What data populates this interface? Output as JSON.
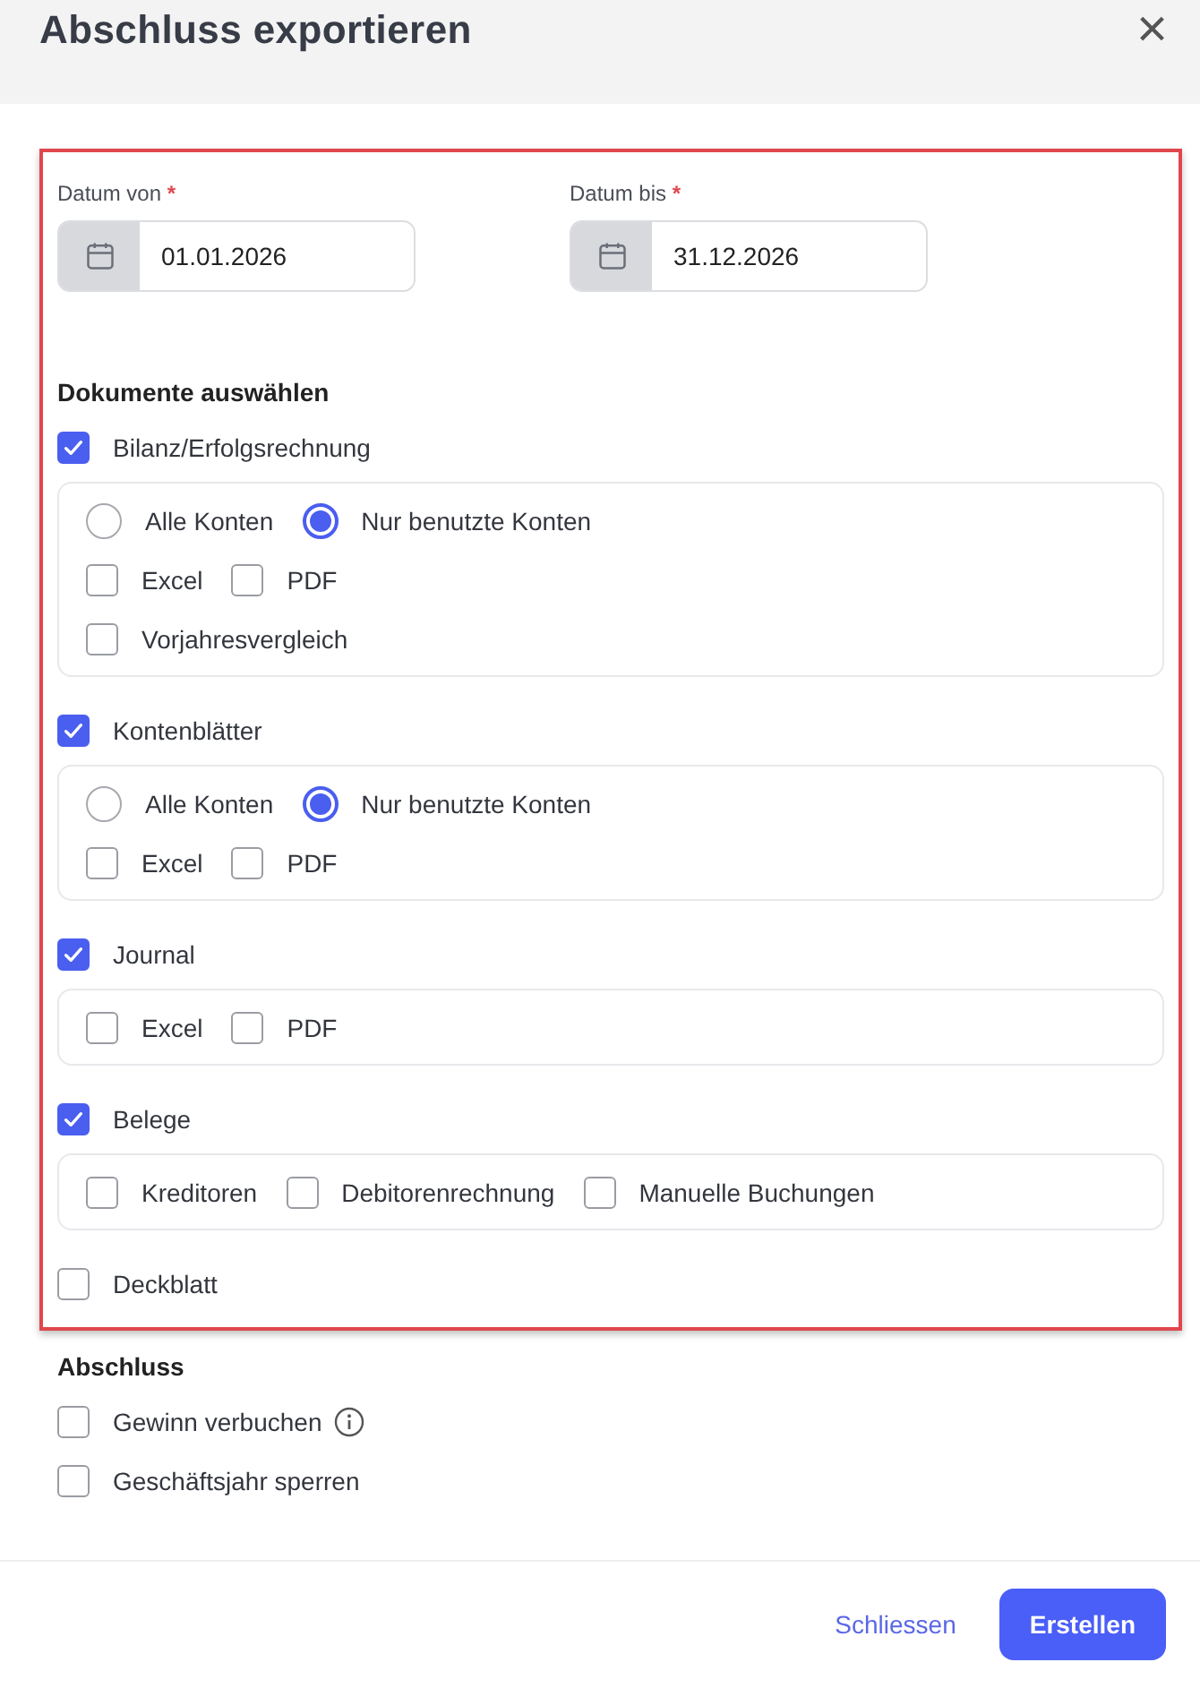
{
  "dialog": {
    "title": "Abschluss exportieren",
    "close": "×"
  },
  "dates": [
    {
      "label": "Datum von",
      "required": "*",
      "value": "01.01.2026"
    },
    {
      "label": "Datum bis",
      "required": "*",
      "value": "31.12.2026"
    }
  ],
  "documents": {
    "heading": "Dokumente auswählen",
    "items": [
      {
        "label": "Bilanz/Erfolgsrechnung",
        "checked": true,
        "options": [
          [
            {
              "kind": "radio",
              "label": "Alle Konten",
              "selected": false
            },
            {
              "kind": "radio",
              "label": "Nur benutzte Konten",
              "selected": true
            }
          ],
          [
            {
              "kind": "checkbox",
              "label": "Excel",
              "checked": false
            },
            {
              "kind": "checkbox",
              "label": "PDF",
              "checked": false
            }
          ],
          [
            {
              "kind": "checkbox",
              "label": "Vorjahresvergleich",
              "checked": false
            }
          ]
        ]
      },
      {
        "label": "Kontenblätter",
        "checked": true,
        "options": [
          [
            {
              "kind": "radio",
              "label": "Alle Konten",
              "selected": false
            },
            {
              "kind": "radio",
              "label": "Nur benutzte Konten",
              "selected": true
            }
          ],
          [
            {
              "kind": "checkbox",
              "label": "Excel",
              "checked": false
            },
            {
              "kind": "checkbox",
              "label": "PDF",
              "checked": false
            }
          ]
        ]
      },
      {
        "label": "Journal",
        "checked": true,
        "options": [
          [
            {
              "kind": "checkbox",
              "label": "Excel",
              "checked": false
            },
            {
              "kind": "checkbox",
              "label": "PDF",
              "checked": false
            }
          ]
        ]
      },
      {
        "label": "Belege",
        "checked": true,
        "options": [
          [
            {
              "kind": "checkbox",
              "label": "Kreditoren",
              "checked": false
            },
            {
              "kind": "checkbox",
              "label": "Debitorenrechnung",
              "checked": false
            },
            {
              "kind": "checkbox",
              "label": "Manuelle Buchungen",
              "checked": false
            }
          ]
        ]
      },
      {
        "label": "Deckblatt",
        "checked": false
      }
    ]
  },
  "closing": {
    "heading": "Abschluss",
    "items": [
      {
        "label": "Gewinn verbuchen",
        "checked": false,
        "info": true
      },
      {
        "label": "Geschäftsjahr sperren",
        "checked": false,
        "info": false
      }
    ]
  },
  "buttons": [
    {
      "kind": "link",
      "label": "Schliessen"
    },
    {
      "kind": "primary",
      "label": "Erstellen"
    }
  ]
}
